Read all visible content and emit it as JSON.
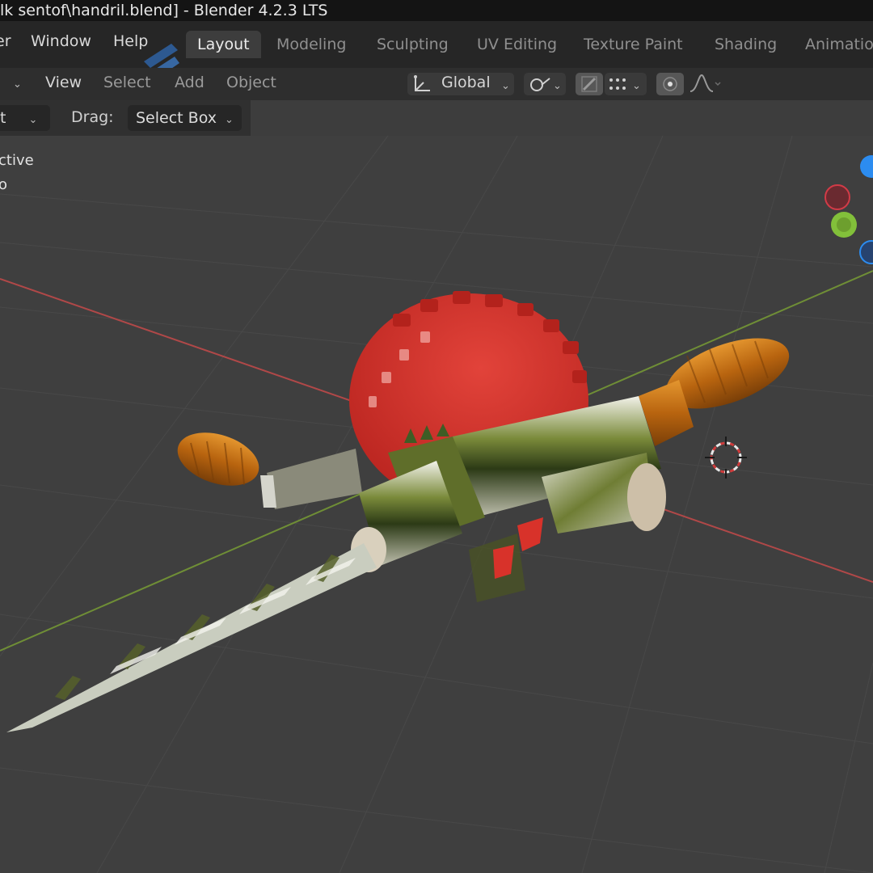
{
  "window": {
    "title": "lk sentof\\handril.blend] - Blender 4.2.3 LTS"
  },
  "menu": {
    "partial_file": "er",
    "window": "Window",
    "help": "Help"
  },
  "workspaces": [
    {
      "label": "Layout",
      "active": true
    },
    {
      "label": "Modeling",
      "active": false
    },
    {
      "label": "Sculpting",
      "active": false
    },
    {
      "label": "UV Editing",
      "active": false
    },
    {
      "label": "Texture Paint",
      "active": false
    },
    {
      "label": "Shading",
      "active": false
    },
    {
      "label": "Animation",
      "active": false
    }
  ],
  "header": {
    "mode_chevron": "⌄",
    "view": "View",
    "select": "Select",
    "add": "Add",
    "object": "Object",
    "orientation": "Global",
    "dropdown_chevron": "⌄"
  },
  "tool_settings": {
    "partial_mode": "t",
    "drag_label": "Drag:",
    "drag_value": "Select Box"
  },
  "viewport": {
    "overlay_line1": "ctive",
    "overlay_line2": "o"
  },
  "colors": {
    "accent_active_tab": "#3d3d3d",
    "gear_red": "#d8322a",
    "handle_orange": "#c46f16",
    "axis_x": "#b04848",
    "axis_y": "#6f8e36",
    "gizmo_x": "#d23b47",
    "gizmo_y": "#82c03a",
    "gizmo_z": "#2c8cf0"
  },
  "icons": {
    "transform_pivot": "transform-pivot-icon",
    "link": "link-icon",
    "snap": "snap-icon",
    "snap_increment": "snap-increment-icon",
    "proportional": "proportional-editing-icon",
    "falloff": "falloff-curve-icon",
    "cursor": "3d-cursor-icon",
    "navigation_gizmo": "navigation-gizmo-icon"
  }
}
